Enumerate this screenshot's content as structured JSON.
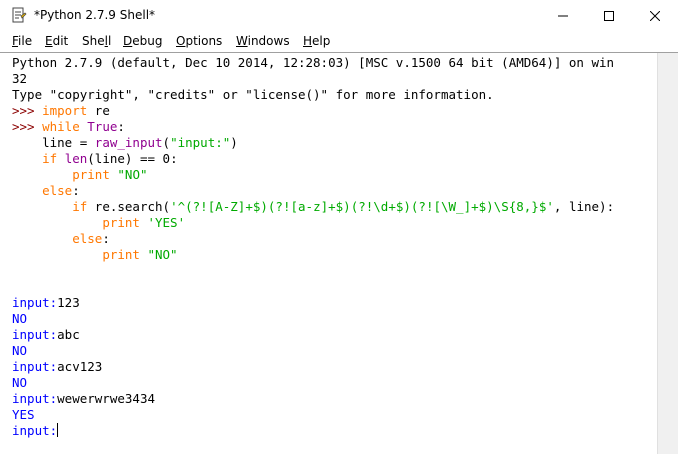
{
  "window": {
    "title": "*Python 2.7.9 Shell*",
    "icon": "python-idle-icon",
    "controls": {
      "minimize": "minimize-icon",
      "maximize": "maximize-icon",
      "close": "close-icon"
    }
  },
  "menu": {
    "file": {
      "u": "F",
      "rest": "ile"
    },
    "edit": {
      "u": "E",
      "rest": "dit"
    },
    "shell": {
      "pre": "She",
      "u": "l",
      "rest": "l"
    },
    "debug": {
      "u": "D",
      "rest": "ebug"
    },
    "options": {
      "u": "O",
      "rest": "ptions"
    },
    "windows": {
      "u": "W",
      "rest": "indows"
    },
    "help": {
      "u": "H",
      "rest": "elp"
    }
  },
  "shell": {
    "banner1": "Python 2.7.9 (default, Dec 10 2014, 12:28:03) [MSC v.1500 64 bit (AMD64)] on win",
    "banner2": "32",
    "banner3": "Type \"copyright\", \"credits\" or \"license()\" for more information.",
    "prompt": ">>> ",
    "code": {
      "l1_kw": "import",
      "l1_rest": " re",
      "l2_kw": "while",
      "l2_sp": " ",
      "l2_true": "True",
      "l2_colon": ":",
      "l3_a": "    line = ",
      "l3_fn": "raw_input",
      "l3_b": "(",
      "l3_str": "\"input:\"",
      "l3_c": ")",
      "l4_a": "    ",
      "l4_kw": "if",
      "l4_sp": " ",
      "l4_fn": "len",
      "l4_b": "(line) == 0:",
      "l5_a": "        ",
      "l5_kw": "print",
      "l5_sp": " ",
      "l5_str": "\"NO\"",
      "l6_a": "    ",
      "l6_kw": "else",
      "l6_b": ":",
      "l7_a": "        ",
      "l7_kw": "if",
      "l7_b": " re.search(",
      "l7_str": "'^(?![A-Z]+$)(?![a-z]+$)(?!\\d+$)(?![\\W_]+$)\\S{8,}$'",
      "l7_c": ", line):",
      "l8_a": "            ",
      "l8_kw": "print",
      "l8_sp": " ",
      "l8_str": "'YES'",
      "l9_a": "        ",
      "l9_kw": "else",
      "l9_b": ":",
      "l10_a": "            ",
      "l10_kw": "print",
      "l10_sp": " ",
      "l10_str": "\"NO\""
    },
    "session": [
      {
        "prompt": "input:",
        "entry": "123"
      },
      {
        "output": "NO"
      },
      {
        "prompt": "input:",
        "entry": "abc"
      },
      {
        "output": "NO"
      },
      {
        "prompt": "input:",
        "entry": "acv123"
      },
      {
        "output": "NO"
      },
      {
        "prompt": "input:",
        "entry": "wewerwrwe3434"
      },
      {
        "output": "YES"
      },
      {
        "prompt": "input:",
        "entry": ""
      }
    ]
  },
  "colors": {
    "prompt": "#8b0000",
    "keyword": "#ff7700",
    "builtin": "#900090",
    "string": "#00aa00",
    "stdout": "#0000ff"
  }
}
